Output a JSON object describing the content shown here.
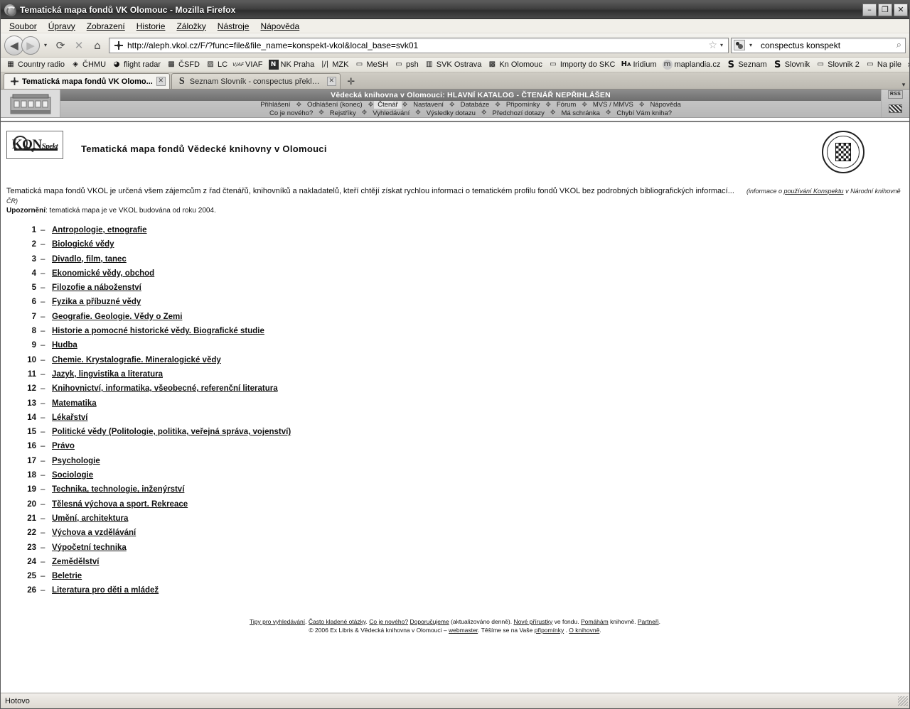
{
  "window": {
    "title": "Tematická mapa fondů VK Olomouc - Mozilla Firefox",
    "minimize_label": "–",
    "maximize_label": "❐",
    "close_label": "✕"
  },
  "menubar": {
    "items": [
      {
        "label": "Soubor"
      },
      {
        "label": "Úpravy"
      },
      {
        "label": "Zobrazení"
      },
      {
        "label": "Historie"
      },
      {
        "label": "Záložky"
      },
      {
        "label": "Nástroje"
      },
      {
        "label": "Nápověda"
      }
    ]
  },
  "toolbar": {
    "back_icon": "◀",
    "forward_icon": "▶",
    "history_dropdown_icon": "▾",
    "reload_icon": "⟳",
    "stop_icon": "✕",
    "home_icon": "⌂",
    "url": "http://aleph.vkol.cz/F/?func=file&file_name=konspekt-vkol&local_base=svk01",
    "star_icon": "☆",
    "urlbar_caret_icon": "▾",
    "search_query": "conspectus konspekt",
    "search_icon": "⌕"
  },
  "bookmarks": {
    "items": [
      {
        "label": "Country radio",
        "icon": "▦"
      },
      {
        "label": "ČHMU",
        "icon": "◈"
      },
      {
        "label": "flight radar",
        "icon": "◕"
      },
      {
        "label": "ČSFD",
        "icon": "▩"
      },
      {
        "label": "LC",
        "icon": "▨"
      },
      {
        "label": "VIAF",
        "icon": "V/AF"
      },
      {
        "label": "NK Praha",
        "icon": "N"
      },
      {
        "label": "MZK",
        "icon": "|/|"
      },
      {
        "label": "MeSH",
        "icon": "▭"
      },
      {
        "label": "psh",
        "icon": "▭"
      },
      {
        "label": "SVK Ostrava",
        "icon": "▥"
      },
      {
        "label": "Kn Olomouc",
        "icon": "▩"
      },
      {
        "label": "Importy do SKC",
        "icon": "▭"
      },
      {
        "label": "Iridium",
        "icon": "HA"
      },
      {
        "label": "maplandia.cz",
        "icon": "m"
      },
      {
        "label": "Seznam",
        "icon": "S"
      },
      {
        "label": "Slovnik",
        "icon": "S"
      },
      {
        "label": "Slovnik 2",
        "icon": "▭"
      },
      {
        "label": "Na pile",
        "icon": "▭"
      }
    ],
    "overflow_icon": "»"
  },
  "tabs": {
    "items": [
      {
        "label": "Tematická mapa fondů VK Olomo...",
        "active": true,
        "close_icon": "✕"
      },
      {
        "label": "Seznam Slovník - conspectus překlad z ...",
        "active": false,
        "close_icon": "✕"
      }
    ],
    "new_tab_icon": "✛",
    "list_all_icon": "▾"
  },
  "aleph_header": {
    "title": "Vědecká knihovna v Olomouci: HLAVNÍ KATALOG - ČTENÁŘ NEPŘIHLÁŠEN",
    "rss_label": "RSS",
    "separator": "✥",
    "row1": [
      {
        "label": "Přihlášení",
        "current": false
      },
      {
        "label": "Odhlášení (konec)",
        "current": false
      },
      {
        "label": "Čtenář",
        "current": true
      },
      {
        "label": "Nastavení",
        "current": false
      },
      {
        "label": "Databáze",
        "current": false
      },
      {
        "label": "Připomínky",
        "current": false
      },
      {
        "label": "Fórum",
        "current": false
      },
      {
        "label": "MVS / MMVS",
        "current": false
      },
      {
        "label": "Nápověda",
        "current": false
      }
    ],
    "row2": [
      {
        "label": "Co je nového?",
        "current": false
      },
      {
        "label": "Rejstříky",
        "current": false
      },
      {
        "label": "Vyhledávání",
        "current": false
      },
      {
        "label": "Výsledky dotazu",
        "current": false
      },
      {
        "label": "Předchozí dotazy",
        "current": false
      },
      {
        "label": "Má schránka",
        "current": false
      },
      {
        "label": "Chybí Vám kniha?",
        "current": false
      }
    ]
  },
  "page": {
    "logo_text": "KON",
    "logo_text_small": "Spekt",
    "heading": "Tematická mapa fondů Vědecké knihovny v Olomouci",
    "intro": "Tematická mapa fondů VKOL je určená všem zájemcům z řad čtenářů, knihovníků a nakladatelů, kteří chtějí získat rychlou informaci o tematickém profilu fondů VKOL bez podrobných bibliografických informací...",
    "intro_note_prefix": "(informace o ",
    "intro_note_link": "používání Konspektu",
    "intro_note_suffix": " v Národní knihovně ČR)",
    "notice_label": "Upozornění",
    "notice_text": ": tematická mapa je ve VKOL budována od roku 2004.",
    "dash": "–"
  },
  "categories": [
    {
      "num": "1",
      "label": "Antropologie, etnografie"
    },
    {
      "num": "2",
      "label": "Biologické vědy"
    },
    {
      "num": "3",
      "label": "Divadlo, film, tanec"
    },
    {
      "num": "4",
      "label": "Ekonomické vědy, obchod"
    },
    {
      "num": "5",
      "label": "Filozofie a náboženství"
    },
    {
      "num": "6",
      "label": "Fyzika a příbuzné vědy"
    },
    {
      "num": "7",
      "label": "Geografie. Geologie. Vědy o Zemi"
    },
    {
      "num": "8",
      "label": "Historie a pomocné historické vědy. Biografické studie"
    },
    {
      "num": "9",
      "label": "Hudba"
    },
    {
      "num": "10",
      "label": "Chemie. Krystalografie. Mineralogické vědy"
    },
    {
      "num": "11",
      "label": "Jazyk, lingvistika a literatura"
    },
    {
      "num": "12",
      "label": "Knihovnictví, informatika, všeobecné, referenční literatura"
    },
    {
      "num": "13",
      "label": "Matematika"
    },
    {
      "num": "14",
      "label": "Lékařství"
    },
    {
      "num": "15",
      "label": "Politické vědy (Politologie, politika, veřejná správa, vojenství)"
    },
    {
      "num": "16",
      "label": "Právo"
    },
    {
      "num": "17",
      "label": "Psychologie"
    },
    {
      "num": "18",
      "label": "Sociologie"
    },
    {
      "num": "19",
      "label": "Technika, technologie, inženýrství"
    },
    {
      "num": "20",
      "label": "Tělesná výchova a sport. Rekreace"
    },
    {
      "num": "21",
      "label": "Umění, architektura"
    },
    {
      "num": "22",
      "label": "Výchova a vzdělávání"
    },
    {
      "num": "23",
      "label": "Výpočetní technika"
    },
    {
      "num": "24",
      "label": "Zemědělství"
    },
    {
      "num": "25",
      "label": "Beletrie"
    },
    {
      "num": "26",
      "label": "Literatura pro děti a mládež"
    }
  ],
  "footer": {
    "line1": [
      {
        "text": "Tipy pro vyhledávání",
        "link": true
      },
      {
        "text": ". ",
        "link": false
      },
      {
        "text": "Často kladené otázky",
        "link": true
      },
      {
        "text": ". ",
        "link": false
      },
      {
        "text": "Co je nového?",
        "link": true
      },
      {
        "text": " ",
        "link": false
      },
      {
        "text": "Doporučujeme",
        "link": true
      },
      {
        "text": " (aktualizováno denně). ",
        "link": false
      },
      {
        "text": "Nové přírustky",
        "link": true
      },
      {
        "text": " ve fondu. ",
        "link": false
      },
      {
        "text": "Pomáhám",
        "link": true
      },
      {
        "text": " knihovně. ",
        "link": false
      },
      {
        "text": "Partneři",
        "link": true
      },
      {
        "text": ".",
        "link": false
      }
    ],
    "line2": [
      {
        "text": "© 2006 Ex Libris & Vědecká knihovna v Olomouci – ",
        "link": false
      },
      {
        "text": "webmaster",
        "link": true
      },
      {
        "text": ". Těšíme se na Vaše ",
        "link": false
      },
      {
        "text": "připomínky",
        "link": true
      },
      {
        "text": " . ",
        "link": false
      },
      {
        "text": "O knihovně",
        "link": true
      },
      {
        "text": ".",
        "link": false
      }
    ]
  },
  "statusbar": {
    "text": "Hotovo"
  }
}
